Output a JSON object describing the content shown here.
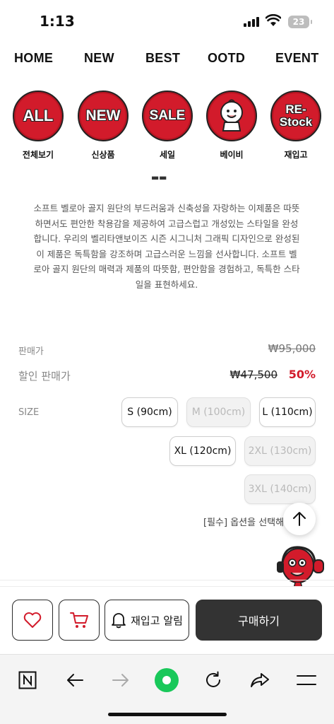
{
  "status_bar": {
    "time": "1:13",
    "battery": "23"
  },
  "top_nav": [
    "HOME",
    "NEW",
    "BEST",
    "OOTD",
    "EVENT"
  ],
  "categories": [
    {
      "badge": "ALL",
      "label": "전체보기"
    },
    {
      "badge": "NEW",
      "label": "신상품"
    },
    {
      "badge": "SALE",
      "label": "세일"
    },
    {
      "badge": "",
      "label": "베이비"
    },
    {
      "badge_line1": "RE-",
      "badge_line2": "Stock",
      "label": "재입고"
    }
  ],
  "product": {
    "description": "소프트 벨로아 골지 원단의 부드러움과 신축성을 자랑하는 이제품은 따뜻하면서도 편안한 착용감을 제공하여 고급스럽고 개성있는 스타일을 완성합니다. 우리의 벨리타앤보이즈 시즌 시그니처 그래픽 디자인으로 완성된 이 제품은 독특함을 강조하며 고급스러운 느낌을 선사합니다. 소프트 벨로아 골지 원단의 매력과 제품의 따뜻함, 편안함을 경험하고, 독특한 스타일을 표현하세요.",
    "price_label": "판매가",
    "price": "₩95,000",
    "sale_price_label": "할인 판매가",
    "sale_price": "₩47,500",
    "discount": "50%",
    "size_label": "SIZE",
    "sizes": [
      {
        "label": "S (90cm)",
        "available": true
      },
      {
        "label": "M (100cm)",
        "available": false
      },
      {
        "label": "L (110cm)",
        "available": true
      },
      {
        "label": "XL (120cm)",
        "available": true
      },
      {
        "label": "2XL (130cm)",
        "available": false
      },
      {
        "label": "3XL (140cm)",
        "available": false
      }
    ],
    "option_notice": "[필수] 옵션을 선택해 주세요"
  },
  "actions": {
    "restock_alert": "재입고 알림",
    "buy": "구매하기"
  },
  "colors": {
    "brand_red": "#d21b2b",
    "buy_button": "#333333"
  }
}
